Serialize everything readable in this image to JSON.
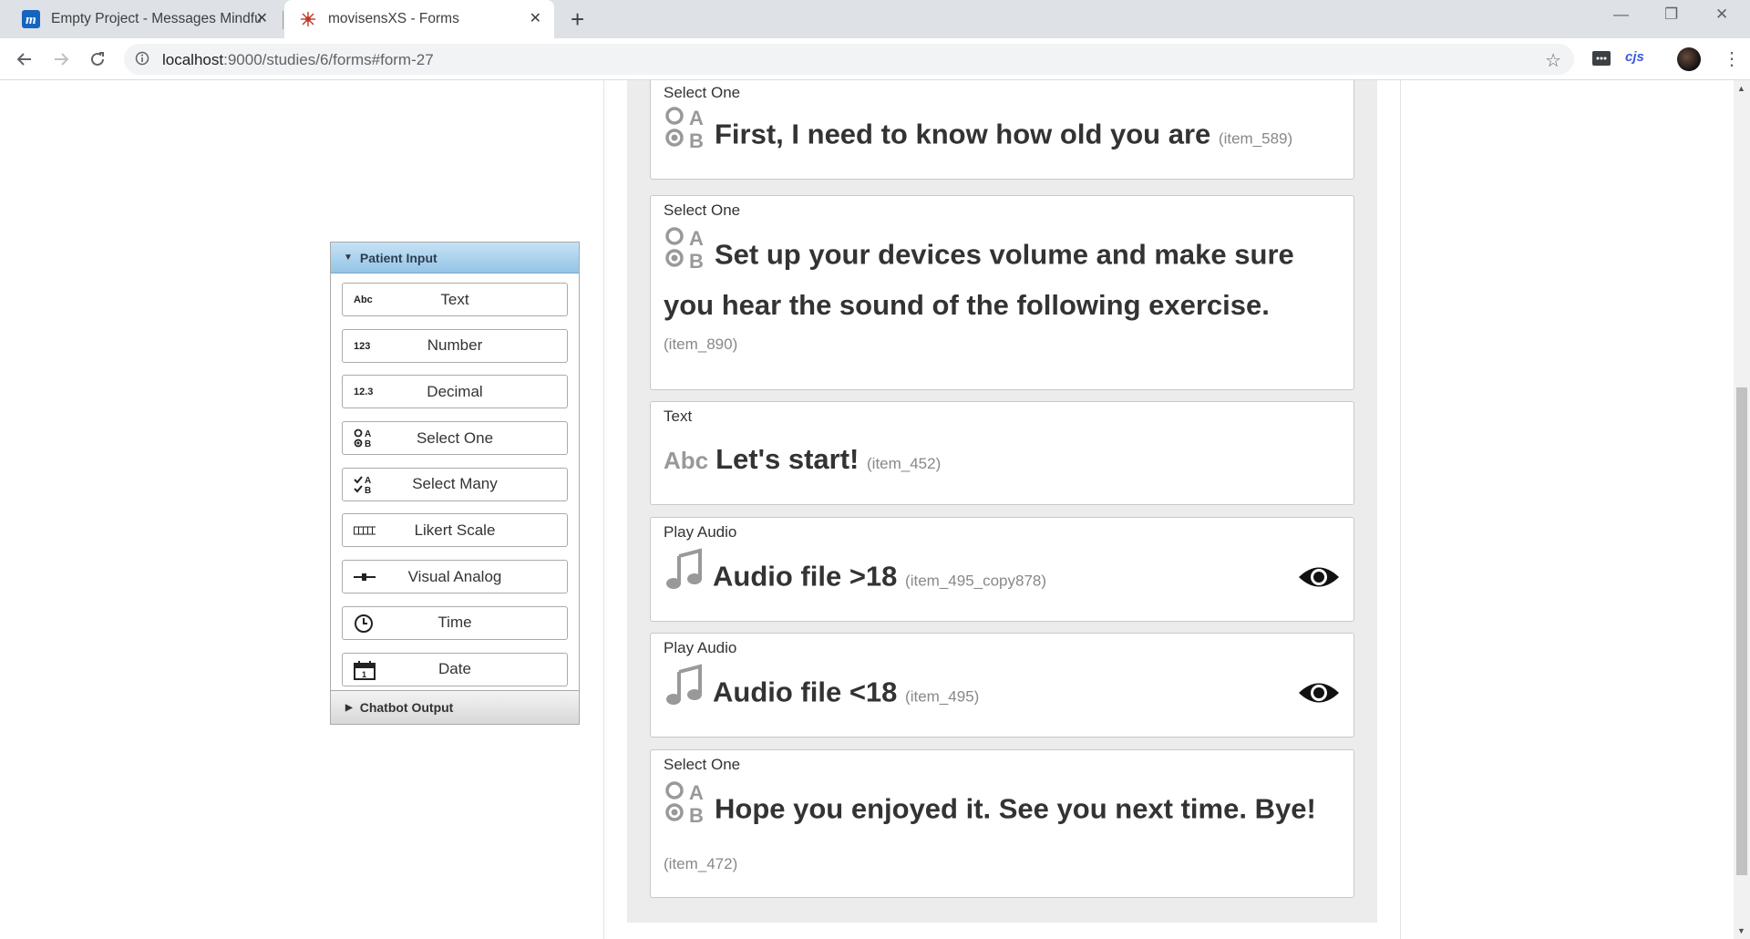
{
  "browser": {
    "tabs": [
      {
        "title": "Empty Project - Messages Mindfu",
        "favicon": "m-logo-icon"
      },
      {
        "title": "movisensXS - Forms",
        "favicon": "movisens-icon",
        "active": true
      }
    ],
    "url_host": "localhost",
    "url_path": ":9000/studies/6/forms#form-27",
    "extension_label": "cjs"
  },
  "palette": {
    "header": "Patient Input",
    "items": [
      {
        "label": "Text",
        "icon_text": "Abc"
      },
      {
        "label": "Number",
        "icon_text": "123"
      },
      {
        "label": "Decimal",
        "icon_text": "12.3"
      },
      {
        "label": "Select One",
        "icon": "select-one-icon"
      },
      {
        "label": "Select Many",
        "icon": "select-many-icon"
      },
      {
        "label": "Likert Scale",
        "icon": "likert-scale-icon"
      },
      {
        "label": "Visual Analog",
        "icon": "visual-analog-icon"
      },
      {
        "label": "Time",
        "icon": "clock-icon"
      },
      {
        "label": "Date",
        "icon": "calendar-icon"
      }
    ],
    "footer": "Chatbot Output"
  },
  "cards": [
    {
      "type": "Select One",
      "text": "First, I need to know how old you are",
      "id": "(item_589)"
    },
    {
      "type": "Select One",
      "text": "Set up your devices volume and make sure you hear the sound of the following exercise.",
      "id": "(item_890)"
    },
    {
      "type": "Text",
      "icon_text": "Abc",
      "text": "Let's start!",
      "id": "(item_452)"
    },
    {
      "type": "Play Audio",
      "text": "Audio file >18",
      "id": "(item_495_copy878)"
    },
    {
      "type": "Play Audio",
      "text": "Audio file <18",
      "id": "(item_495)"
    },
    {
      "type": "Select One",
      "text": "Hope you enjoyed it. See you next time. Bye!",
      "id": "(item_472)"
    }
  ],
  "colors": {
    "palette_header": "#94c4e6",
    "form_background": "#ececec"
  }
}
